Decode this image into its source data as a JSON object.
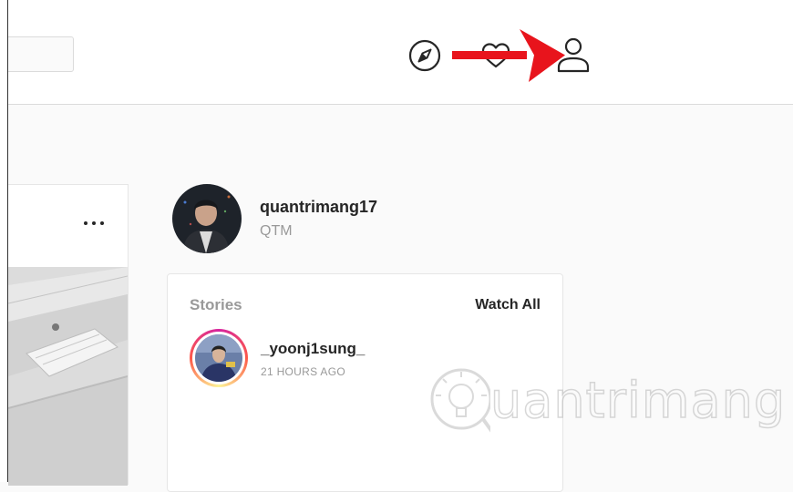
{
  "topbar": {
    "search": {
      "value": "",
      "placeholder": ""
    },
    "icons": [
      "compass-icon",
      "heart-icon",
      "profile-icon"
    ],
    "annotation_arrow_color": "#e8141c"
  },
  "post": {
    "more_label": "..."
  },
  "profile": {
    "username": "quantrimang17",
    "full_name": "QTM"
  },
  "stories": {
    "title": "Stories",
    "watch_all_label": "Watch All",
    "items": [
      {
        "username": "_yoonj1sung_",
        "time": "21 HOURS AGO"
      }
    ]
  },
  "watermark": {
    "text": "uantrimang"
  },
  "colors": {
    "text_primary": "#262626",
    "text_secondary": "#999999",
    "border": "#dbdbdb",
    "background": "#fafafa"
  }
}
